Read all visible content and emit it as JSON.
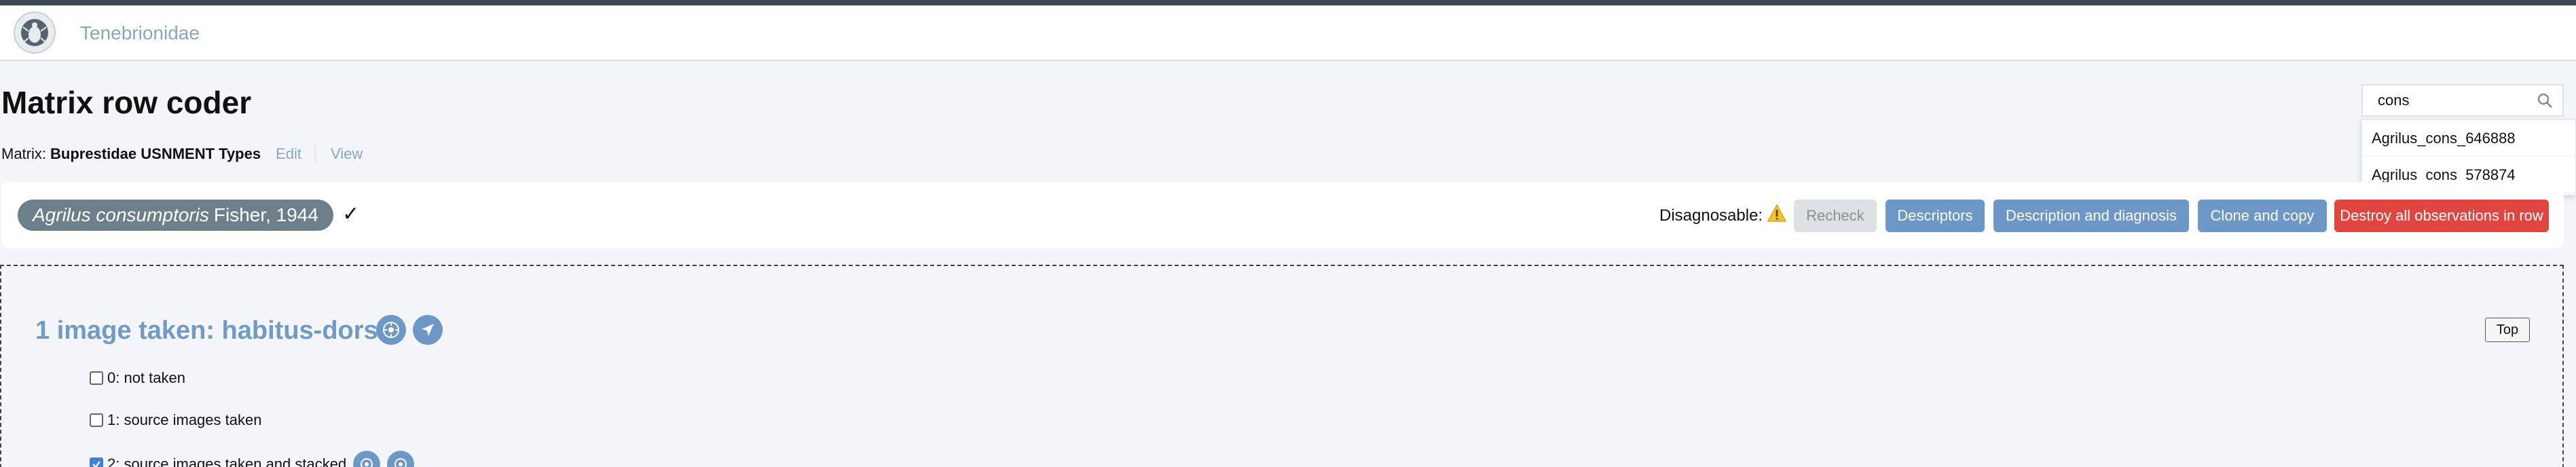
{
  "navbar": {
    "project_name": "Tenebrionidae"
  },
  "page": {
    "title": "Matrix row coder"
  },
  "matrix": {
    "label": "Matrix:",
    "name": "Buprestidae USNMENT Types",
    "edit_label": "Edit",
    "view_label": "View"
  },
  "search": {
    "value": "cons",
    "results": [
      "Agrilus_cons_646888",
      "Agrilus_cons_578874"
    ]
  },
  "row": {
    "otu_scientific": "Agrilus consumptoris",
    "otu_author": "Fisher, 1944",
    "check_mark": "✓",
    "diagnosable_label": "Disagnosable:",
    "buttons": {
      "recheck": "Recheck",
      "descriptors": "Descriptors",
      "description": "Description and diagnosis",
      "clone": "Clone and copy",
      "destroy": "Destroy all observations in row"
    }
  },
  "descriptor": {
    "title": "1 image taken: habitus-dorsal",
    "top_label": "Top",
    "states": [
      {
        "label": "0: not taken",
        "checked": false
      },
      {
        "label": "1: source images taken",
        "checked": false
      },
      {
        "label": "2: source images taken and stacked",
        "checked": true
      }
    ]
  },
  "colors": {
    "accent": "#6c97c6",
    "danger": "#e0463f",
    "badge": "#6e7f8c",
    "warning": "#f2c230"
  },
  "icons": {
    "logo": "beetle-logo-icon",
    "search": "search-icon",
    "warning": "warning-icon",
    "depiction": "image-icon",
    "navigate": "navigate-icon"
  }
}
